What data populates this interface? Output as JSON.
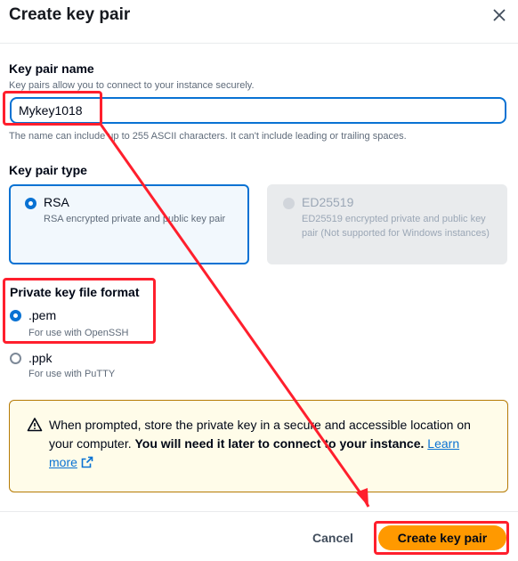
{
  "dialog": {
    "title": "Create key pair",
    "close_icon": "close-icon"
  },
  "name_field": {
    "label": "Key pair name",
    "description": "Key pairs allow you to connect to your instance securely.",
    "value": "Mykey1018",
    "constraint": "The name can include up to 255 ASCII characters. It can't include leading or trailing spaces."
  },
  "key_type": {
    "label": "Key pair type",
    "options": [
      {
        "title": "RSA",
        "description": "RSA encrypted private and public key pair",
        "selected": true,
        "disabled": false
      },
      {
        "title": "ED25519",
        "description": "ED25519 encrypted private and public key pair (Not supported for Windows instances)",
        "selected": false,
        "disabled": true
      }
    ]
  },
  "file_format": {
    "label": "Private key file format",
    "options": [
      {
        "title": ".pem",
        "description": "For use with OpenSSH",
        "selected": true
      },
      {
        "title": ".ppk",
        "description": "For use with PuTTY",
        "selected": false
      }
    ]
  },
  "alert": {
    "icon": "warning-icon",
    "text": "When prompted, store the private key in a secure and accessible location on your computer. ",
    "bold_text": "You will need it later to connect to your instance.",
    "link_text": "Learn more",
    "link_icon": "external-link-icon"
  },
  "footer": {
    "cancel_label": "Cancel",
    "create_label": "Create key pair"
  },
  "colors": {
    "accent": "#0972d3",
    "primary_button": "#ff9900",
    "annotation": "#ff1f2d",
    "warning_border": "#b57a04",
    "warning_bg": "#fffce9"
  }
}
